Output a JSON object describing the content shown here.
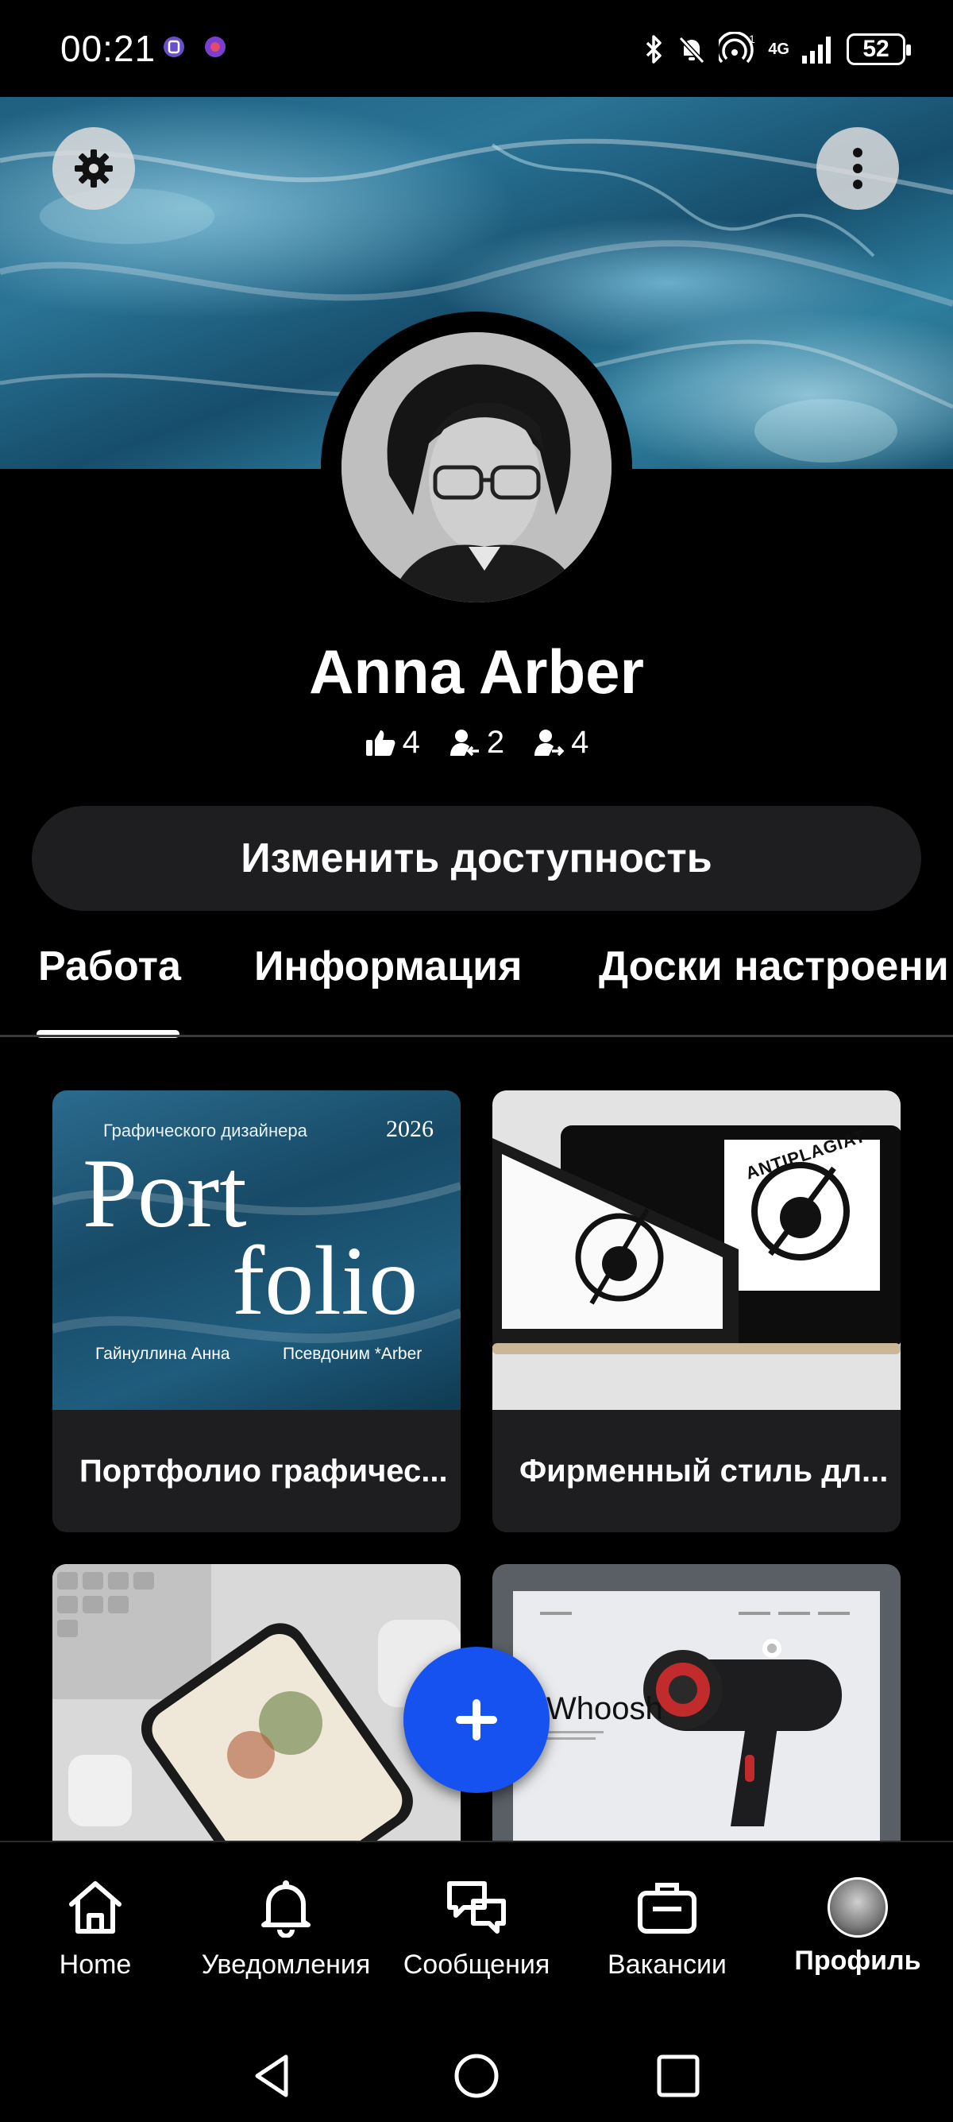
{
  "status_bar": {
    "time": "00:21",
    "network": "4G",
    "battery": "52"
  },
  "profile": {
    "name": "Anna Arber",
    "stats": [
      {
        "icon": "thumbs-up-icon",
        "value": "4"
      },
      {
        "icon": "followers-icon",
        "value": "2"
      },
      {
        "icon": "following-icon",
        "value": "4"
      }
    ],
    "availability_button": "Изменить доступность"
  },
  "tabs": [
    {
      "label": "Работа",
      "active": true
    },
    {
      "label": "Информация",
      "active": false
    },
    {
      "label": "Доски настроени",
      "active": false
    }
  ],
  "works": [
    {
      "title": "Портфолио графичес...",
      "cover": {
        "top_left": "Графического дизайнера",
        "year": "2026",
        "line1": "Port",
        "line2": "folio",
        "author": "Гайнуллина  Анна",
        "alias": "Псевдоним *Arber"
      }
    },
    {
      "title": "Фирменный стиль дл...",
      "cover": {
        "brand": "ANTIPLAGIAT"
      }
    },
    {
      "title": "",
      "cover": {}
    },
    {
      "title": "",
      "cover": {
        "headline": "Whoosh"
      }
    }
  ],
  "bottom_nav": [
    {
      "label": "Home",
      "icon": "home-icon",
      "active": false
    },
    {
      "label": "Уведомления",
      "icon": "bell-icon",
      "active": false
    },
    {
      "label": "Сообщения",
      "icon": "chat-icon",
      "active": false
    },
    {
      "label": "Вакансии",
      "icon": "briefcase-icon",
      "active": false
    },
    {
      "label": "Профиль",
      "icon": "profile-avatar-icon",
      "active": true
    }
  ],
  "colors": {
    "accent": "#1652f0",
    "background": "#000000",
    "surface": "#1e1e20"
  }
}
